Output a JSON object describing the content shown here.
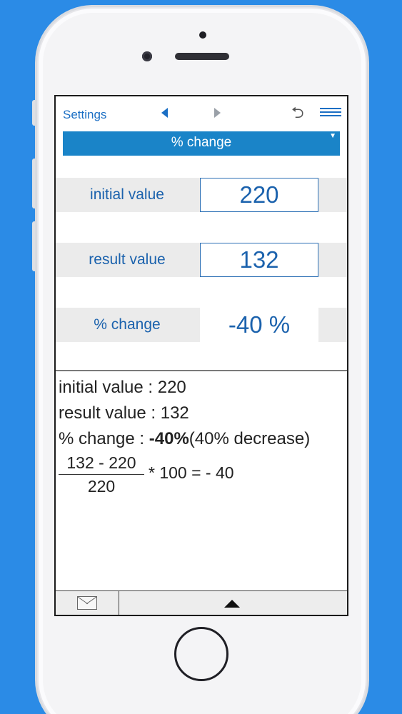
{
  "toolbar": {
    "settings_label": "Settings",
    "prev_icon": "triangle-left-icon",
    "next_icon": "triangle-right-icon",
    "undo_icon": "undo-icon",
    "menu_icon": "hamburger-menu-icon",
    "undo_glyph": "⮌"
  },
  "mode_select": {
    "selected": "% change",
    "caret": "▼"
  },
  "fields": {
    "initial": {
      "label": "initial value",
      "value": "220"
    },
    "result": {
      "label": "result value",
      "value": "132"
    },
    "change": {
      "label": "% change",
      "value": "-40 %"
    }
  },
  "results": {
    "line1": "initial value : 220",
    "line2": "result value : 132",
    "line3_prefix": "% change : ",
    "line3_bold": "-40%",
    "line3_suffix": "(40% decrease)",
    "fraction_numerator": "132 - 220",
    "fraction_denominator": "220",
    "fraction_rest": "* 100 = - 40"
  },
  "bottom_bar": {
    "mail_icon": "envelope-icon",
    "expand_icon": "triangle-up-icon"
  },
  "colors": {
    "background": "#2b8be6",
    "accent": "#1b62ad",
    "select_bar": "#1a84c8"
  }
}
